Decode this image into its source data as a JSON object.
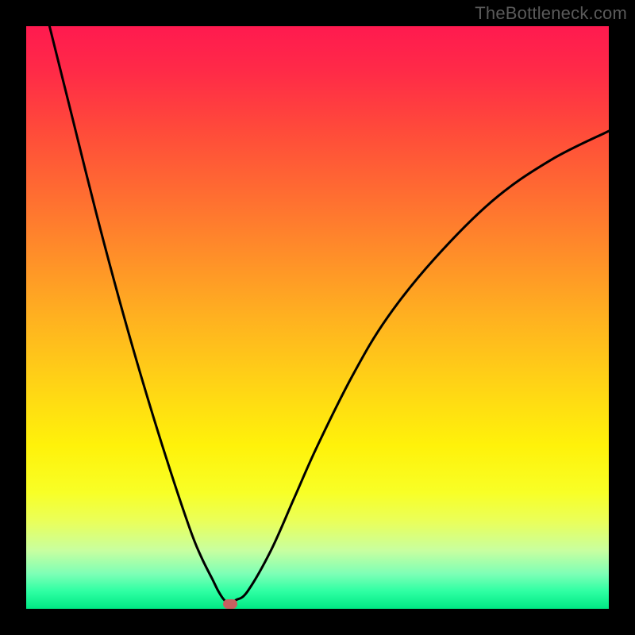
{
  "watermark": "TheBottleneck.com",
  "chart_data": {
    "type": "line",
    "title": "",
    "xlabel": "",
    "ylabel": "",
    "xlim": [
      0,
      100
    ],
    "ylim": [
      0,
      100
    ],
    "grid": false,
    "legend": false,
    "series": [
      {
        "name": "curve",
        "color": "#000000",
        "x": [
          4,
          8,
          12,
          16,
          20,
          24,
          28,
          30,
          32,
          33,
          34,
          35,
          36,
          38,
          42,
          46,
          50,
          56,
          62,
          70,
          80,
          90,
          100
        ],
        "y": [
          100,
          84,
          68,
          53,
          39,
          26,
          14,
          9,
          5,
          3,
          1.5,
          1,
          1.5,
          3,
          10,
          19,
          28,
          40,
          50,
          60,
          70,
          77,
          82
        ]
      }
    ],
    "marker": {
      "x": 35,
      "y": 0.8,
      "color": "#c76060"
    },
    "background_gradient": {
      "top": "#ff1a4f",
      "bottom": "#00e884"
    }
  }
}
